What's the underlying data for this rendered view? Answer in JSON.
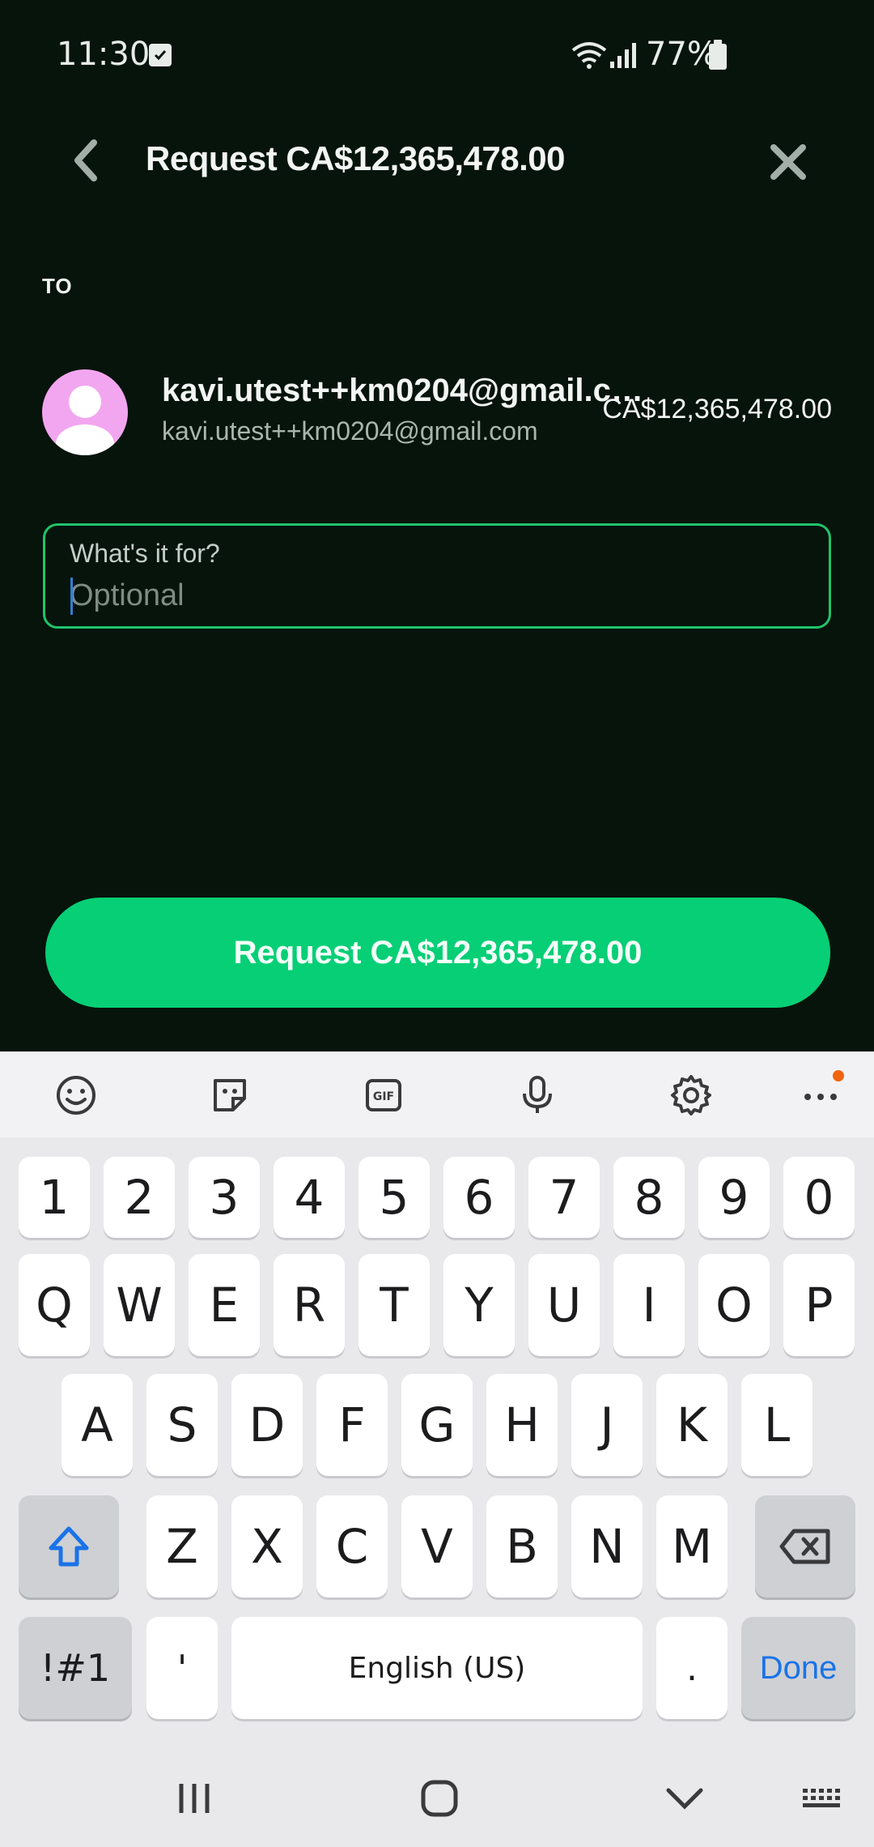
{
  "status": {
    "time": "11:30",
    "battery": "77%"
  },
  "appbar": {
    "title": "Request CA$12,365,478.00"
  },
  "to_label": "TO",
  "recipient": {
    "name": "kavi.utest++km0204@gmail.com",
    "email": "kavi.utest++km0204@gmail.com",
    "amount": "CA$12,365,478.00"
  },
  "note": {
    "label": "What's it for?",
    "placeholder": "Optional"
  },
  "request_button": "Request CA$12,365,478.00",
  "keyboard": {
    "row_numbers": [
      "1",
      "2",
      "3",
      "4",
      "5",
      "6",
      "7",
      "8",
      "9",
      "0"
    ],
    "row_q": [
      "Q",
      "W",
      "E",
      "R",
      "T",
      "Y",
      "U",
      "I",
      "O",
      "P"
    ],
    "row_a": [
      "A",
      "S",
      "D",
      "F",
      "G",
      "H",
      "J",
      "K",
      "L"
    ],
    "row_z": [
      "Z",
      "X",
      "C",
      "V",
      "B",
      "N",
      "M"
    ],
    "symbols": "!#1",
    "apostrophe": "'",
    "space": "English (US)",
    "period": ".",
    "done": "Done"
  },
  "colors": {
    "background": "#06140b",
    "accent": "#06cf76",
    "field_border": "#20c36b",
    "avatar": "#f3a6f0"
  }
}
